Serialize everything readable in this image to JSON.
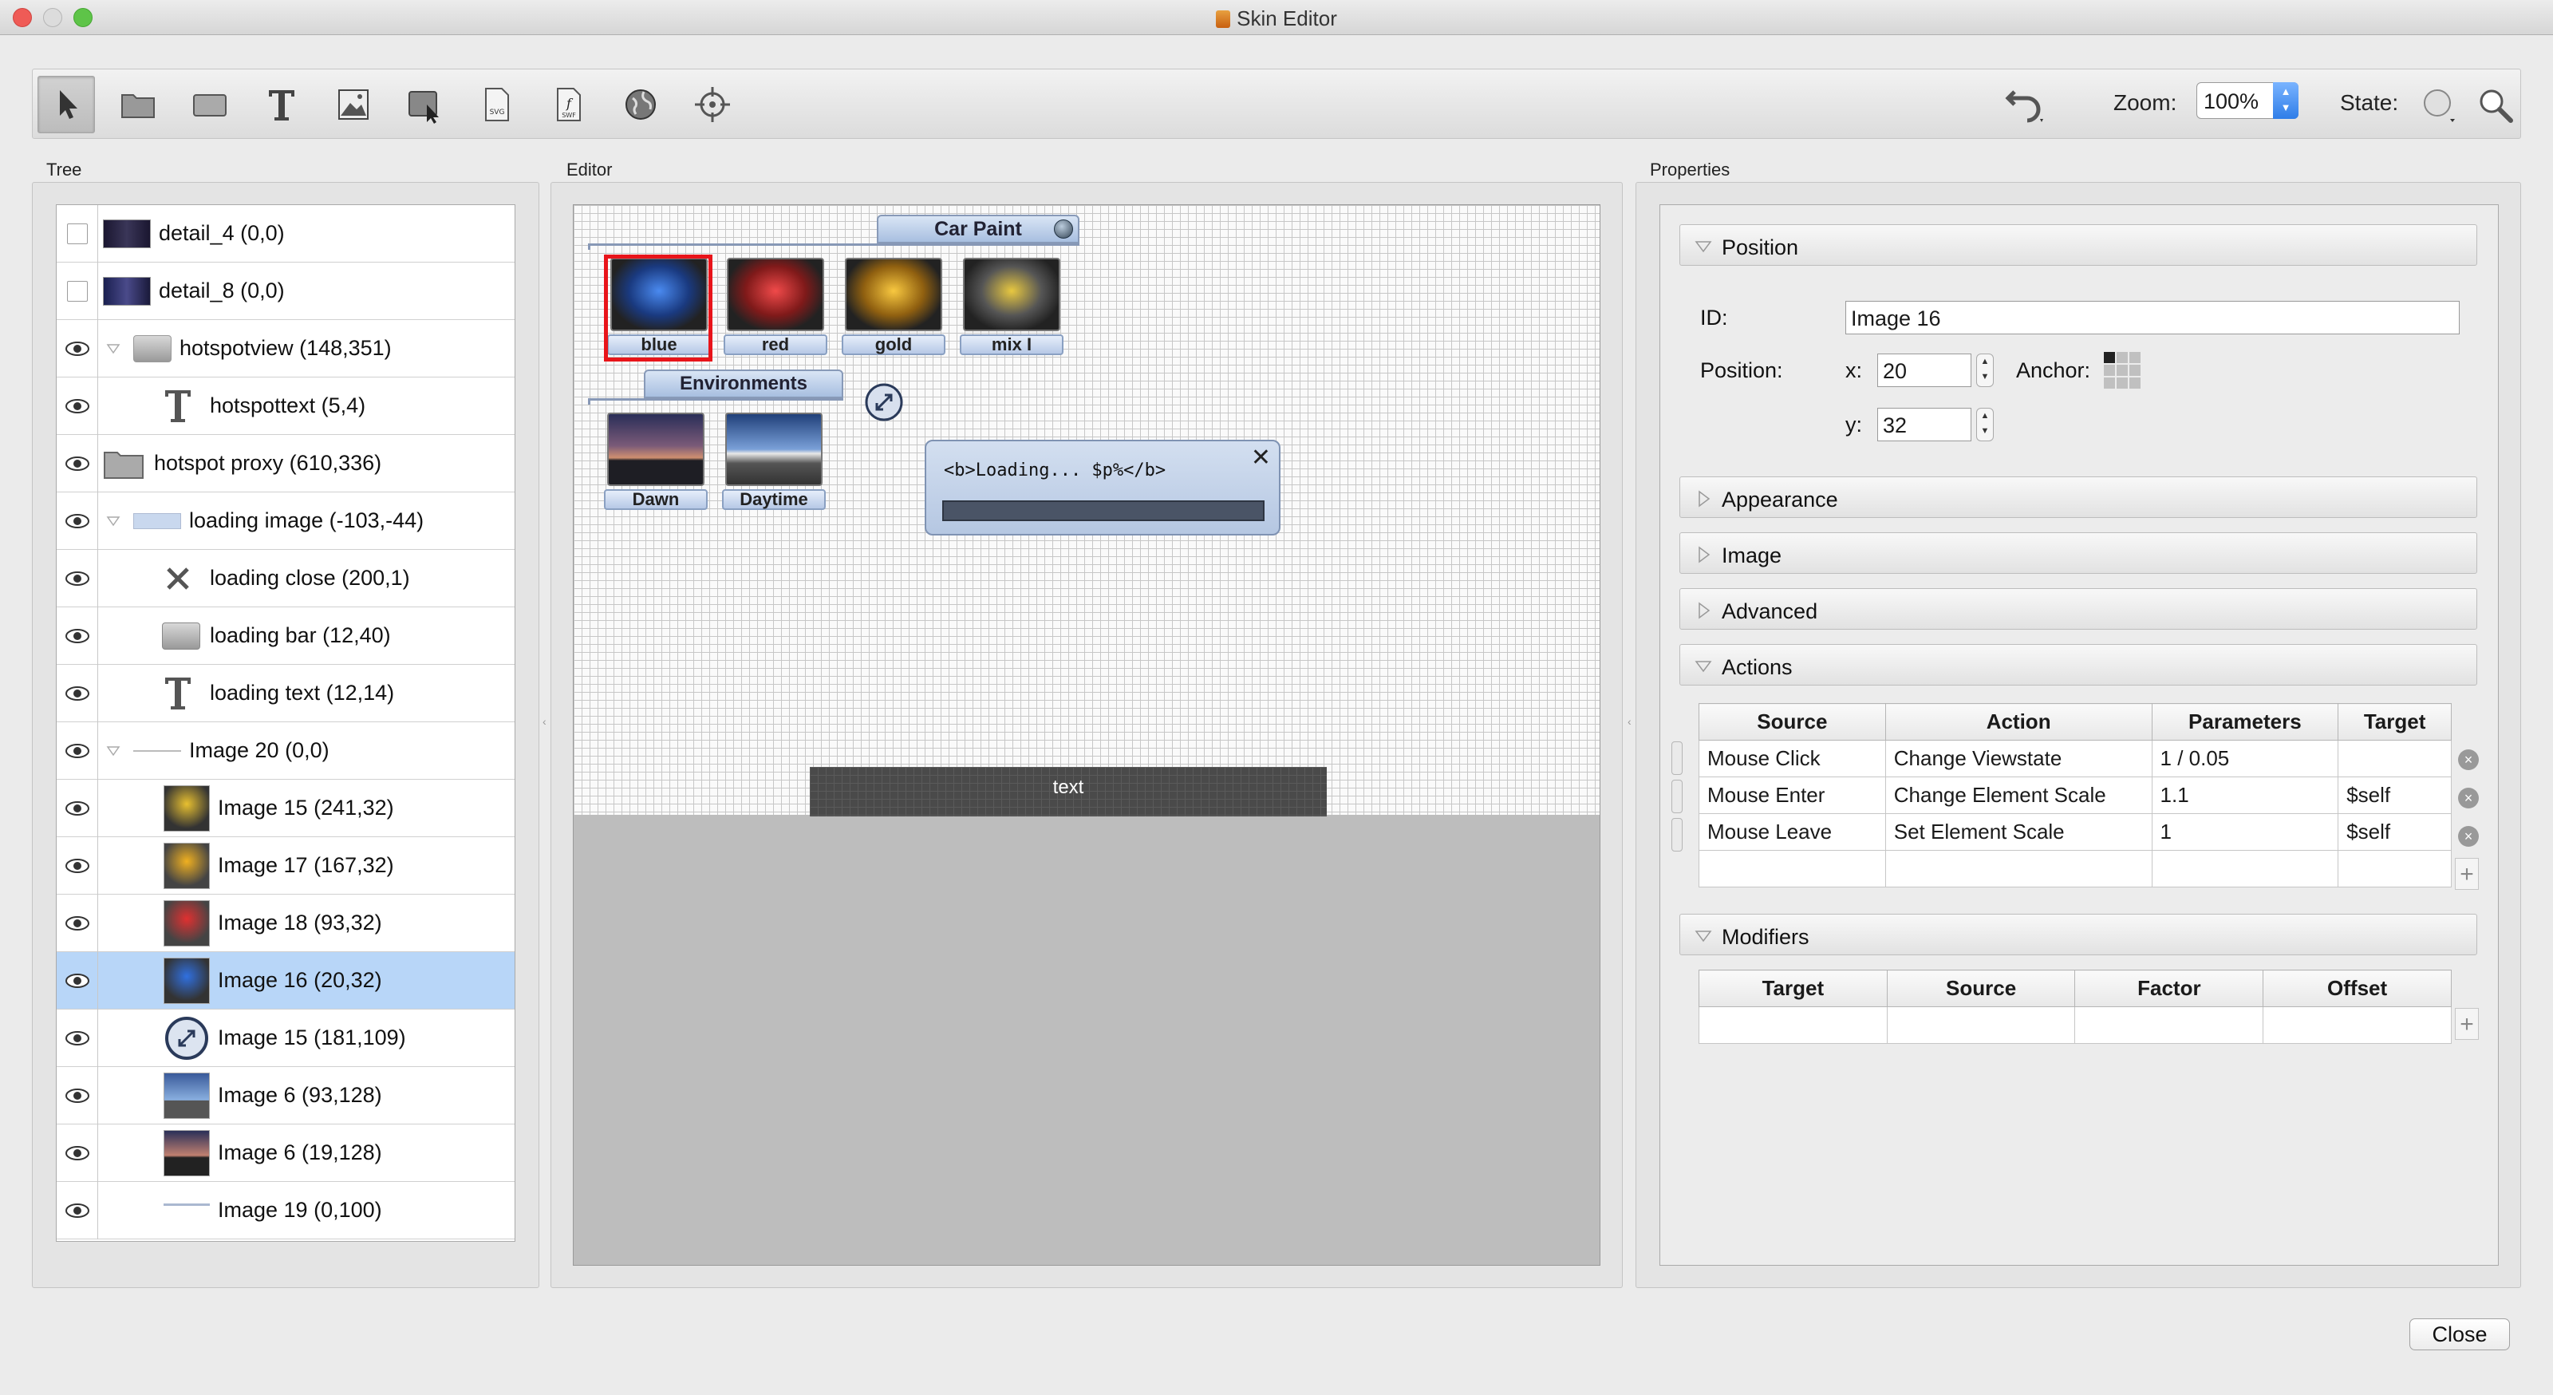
{
  "window": {
    "title": "Skin Editor"
  },
  "toolbar": {
    "tools": [
      {
        "name": "select-tool",
        "icon": "pointer-icon"
      },
      {
        "name": "container-tool",
        "icon": "folder-icon"
      },
      {
        "name": "rectangle-tool",
        "icon": "rectangle-icon"
      },
      {
        "name": "text-tool",
        "icon": "text-icon"
      },
      {
        "name": "image-tool",
        "icon": "image-icon"
      },
      {
        "name": "button-tool",
        "icon": "button-icon"
      },
      {
        "name": "svg-tool",
        "icon": "svg-icon"
      },
      {
        "name": "swf-tool",
        "icon": "swf-icon"
      },
      {
        "name": "hotspot-tool",
        "icon": "globe-icon"
      },
      {
        "name": "crosshair-tool",
        "icon": "crosshair-icon"
      }
    ],
    "zoom_label": "Zoom:",
    "zoom_value": "100%",
    "state_label": "State:"
  },
  "tree": {
    "label": "Tree",
    "rows": [
      {
        "label": "detail_4 (0,0)",
        "visible": false,
        "indent": 0,
        "thumb": "dark-car"
      },
      {
        "label": "detail_8 (0,0)",
        "visible": false,
        "indent": 0,
        "thumb": "dark-car2"
      },
      {
        "label": "hotspotview (148,351)",
        "visible": true,
        "indent": 0,
        "expandable": true,
        "thumb": "gray-rect"
      },
      {
        "label": "hotspottext (5,4)",
        "visible": true,
        "indent": 1,
        "thumb": "text"
      },
      {
        "label": "hotspot proxy (610,336)",
        "visible": true,
        "indent": 0,
        "thumb": "folder"
      },
      {
        "label": "loading image (-103,-44)",
        "visible": true,
        "indent": 0,
        "expandable": true,
        "thumb": "bluebar"
      },
      {
        "label": "loading close (200,1)",
        "visible": true,
        "indent": 1,
        "thumb": "close-x"
      },
      {
        "label": "loading bar (12,40)",
        "visible": true,
        "indent": 1,
        "thumb": "gray-rect"
      },
      {
        "label": "loading text (12,14)",
        "visible": true,
        "indent": 1,
        "thumb": "text"
      },
      {
        "label": "Image 20 (0,0)",
        "visible": true,
        "indent": 0,
        "expandable": true,
        "thumb": "line"
      },
      {
        "label": "Image 15 (241,32)",
        "visible": true,
        "indent": 1,
        "thumb": "car-mix"
      },
      {
        "label": "Image 17 (167,32)",
        "visible": true,
        "indent": 1,
        "thumb": "car-gold"
      },
      {
        "label": "Image 18 (93,32)",
        "visible": true,
        "indent": 1,
        "thumb": "car-red"
      },
      {
        "label": "Image 16 (20,32)",
        "visible": true,
        "indent": 1,
        "thumb": "car-blue",
        "selected": true
      },
      {
        "label": "Image 15 (181,109)",
        "visible": true,
        "indent": 1,
        "thumb": "fullscreen"
      },
      {
        "label": "Image 6 (93,128)",
        "visible": true,
        "indent": 1,
        "thumb": "daytime"
      },
      {
        "label": "Image 6 (19,128)",
        "visible": true,
        "indent": 1,
        "thumb": "dawn"
      },
      {
        "label": "Image 19 (0,100)",
        "visible": true,
        "indent": 1,
        "thumb": "line"
      }
    ]
  },
  "editor": {
    "label": "Editor",
    "car_paint_title": "Car Paint",
    "tiles": [
      {
        "label": "blue",
        "color": "#2a6ad0"
      },
      {
        "label": "red",
        "color": "#d02a2a"
      },
      {
        "label": "gold",
        "color": "#e0a81a"
      },
      {
        "label": "mix I",
        "color": "#c8a020"
      }
    ],
    "environments_title": "Environments",
    "env_tiles": [
      {
        "label": "Dawn"
      },
      {
        "label": "Daytime"
      }
    ],
    "loading_text": "<b>Loading... $p%</b>",
    "text_bar": "text"
  },
  "properties": {
    "label": "Properties",
    "sections": {
      "position": "Position",
      "appearance": "Appearance",
      "image": "Image",
      "advanced": "Advanced",
      "actions": "Actions",
      "modifiers": "Modifiers"
    },
    "id_label": "ID:",
    "id_value": "Image 16",
    "position_label": "Position:",
    "x_label": "x:",
    "x_value": "20",
    "y_label": "y:",
    "y_value": "32",
    "anchor_label": "Anchor:",
    "actions_table": {
      "headers": [
        "Source",
        "Action",
        "Parameters",
        "Target"
      ],
      "rows": [
        [
          "Mouse Click",
          "Change Viewstate",
          "1 / 0.05",
          ""
        ],
        [
          "Mouse Enter",
          "Change Element Scale",
          "1.1",
          "$self"
        ],
        [
          "Mouse Leave",
          "Set Element Scale",
          "1",
          "$self"
        ]
      ]
    },
    "modifiers_table": {
      "headers": [
        "Target",
        "Source",
        "Factor",
        "Offset"
      ]
    }
  },
  "footer": {
    "close_label": "Close"
  }
}
